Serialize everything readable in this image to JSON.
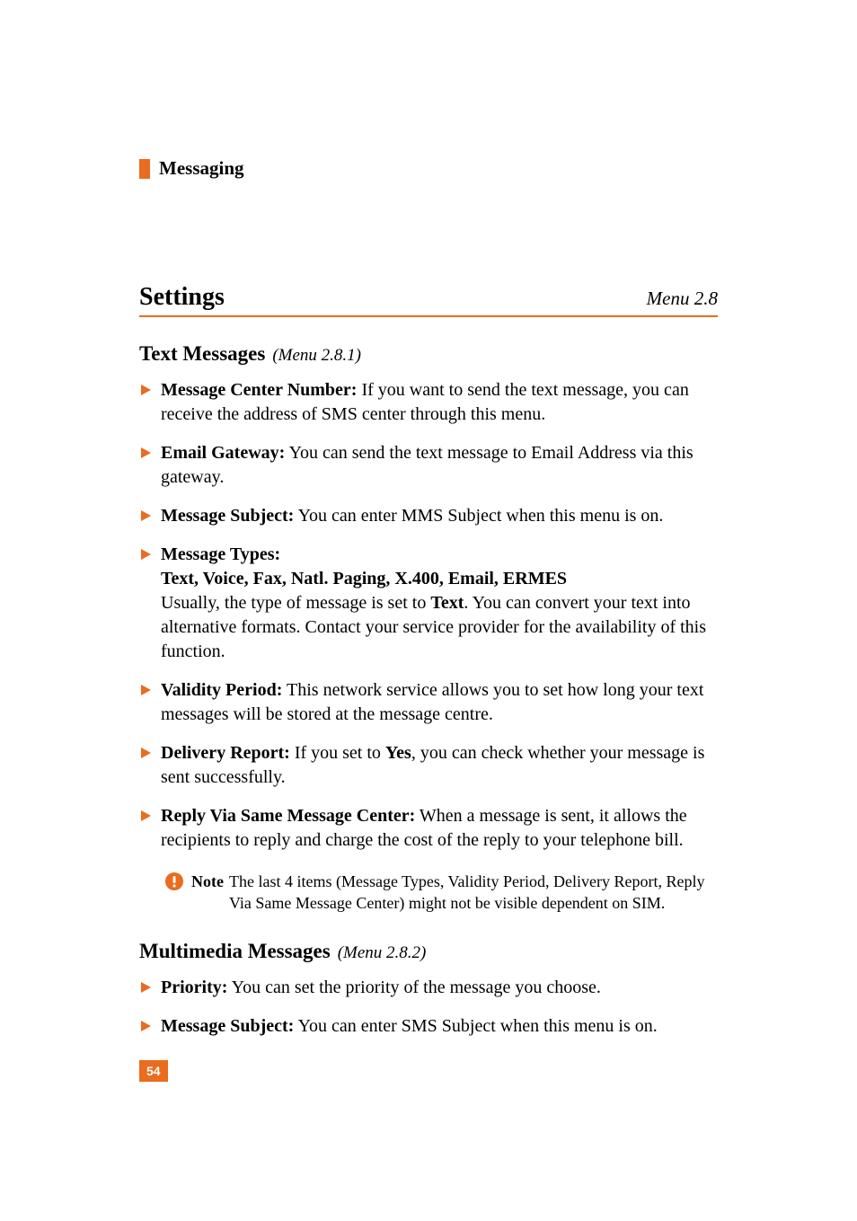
{
  "chapter": {
    "title": "Messaging"
  },
  "section": {
    "title": "Settings",
    "menu": "Menu 2.8"
  },
  "sub1": {
    "title": "Text Messages",
    "menu": "(Menu 2.8.1)",
    "items": [
      {
        "label": "Message Center Number:",
        "text": " If you want to send the text message, you can receive the address of SMS center through this menu."
      },
      {
        "label": "Email Gateway:",
        "text": " You can send the text message to Email Address via this gateway."
      },
      {
        "label": "Message Subject:",
        "text": " You can enter MMS Subject when this menu is on."
      },
      {
        "label": "Message Types:",
        "subbold": "Text, Voice, Fax, Natl. Paging, X.400, Email, ERMES",
        "text_pre": "Usually, the type of message is set to ",
        "text_bold": "Text",
        "text_post": ". You can convert your text into alternative formats. Contact your service provider for the availability of this function."
      },
      {
        "label": "Validity Period:",
        "text": " This network service allows you to set how long your text messages will be stored at the message centre."
      },
      {
        "label": "Delivery Report:",
        "text_pre": " If you set to ",
        "text_bold": "Yes",
        "text_post": ", you can check whether your message is sent successfully."
      },
      {
        "label": "Reply Via Same Message Center:",
        "text": " When a message is sent, it allows the recipients to reply and charge the cost of the reply to your telephone bill."
      }
    ]
  },
  "note": {
    "label": "Note",
    "text": "The last 4 items (Message Types, Validity Period, Delivery Report, Reply Via Same Message Center) might not be visible dependent on SIM."
  },
  "sub2": {
    "title": "Multimedia Messages",
    "menu": "(Menu 2.8.2)",
    "items": [
      {
        "label": "Priority:",
        "text": " You can set the priority of the message you choose."
      },
      {
        "label": "Message Subject:",
        "text": " You can enter SMS Subject when this menu is on."
      }
    ]
  },
  "page_number": "54",
  "colors": {
    "accent": "#e96c1f"
  }
}
